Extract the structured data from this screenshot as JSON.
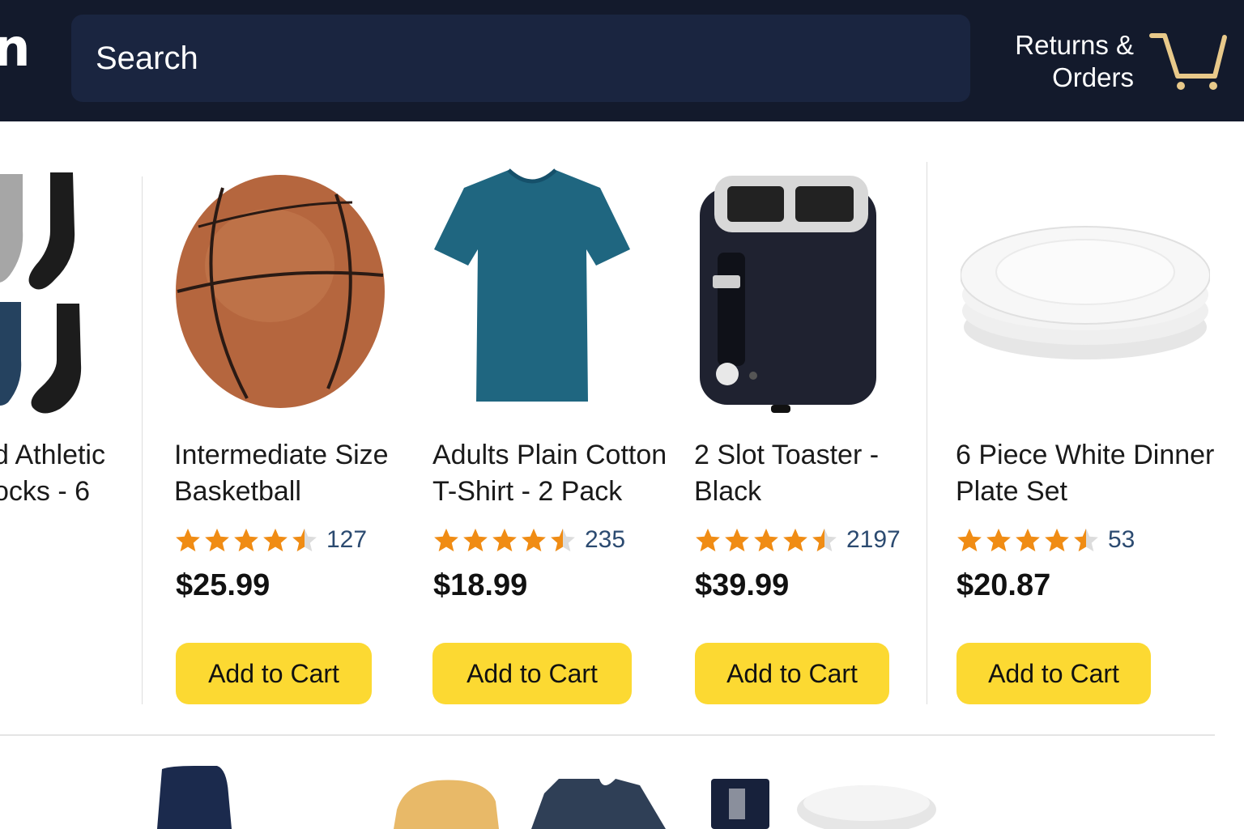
{
  "header": {
    "logo_text": "n",
    "search_placeholder": "Search",
    "returns_line1": "Returns &",
    "returns_line2": "Orders",
    "cart_icon": "cart-icon"
  },
  "colors": {
    "header_bg": "#131a2c",
    "search_bg": "#1a2540",
    "button": "#fcd932",
    "star": "#f08c14",
    "cart_icon": "#e8c98a",
    "rating_count": "#2b4a70"
  },
  "products": [
    {
      "title_line1": "d Athletic",
      "title_line2": "ocks - 6",
      "image": "socks-image"
    },
    {
      "title_line1": "Intermediate Size",
      "title_line2": "Basketball",
      "rating": 4.5,
      "review_count": "127",
      "price": "$25.99",
      "button_label": "Add to Cart",
      "image": "basketball-image"
    },
    {
      "title_line1": "Adults Plain Cotton",
      "title_line2": "T-Shirt - 2 Pack",
      "rating": 4.5,
      "review_count": "235",
      "price": "$18.99",
      "button_label": "Add to Cart",
      "image": "tshirt-image"
    },
    {
      "title_line1": "2 Slot Toaster -",
      "title_line2": "Black",
      "rating": 4.5,
      "review_count": "2197",
      "price": "$39.99",
      "button_label": "Add to Cart",
      "image": "toaster-image"
    },
    {
      "title_line1": "6 Piece White Dinner",
      "title_line2": "Plate Set",
      "rating": 4.5,
      "review_count": "53",
      "price": "$20.87",
      "button_label": "Add to Cart",
      "image": "plates-image"
    }
  ]
}
